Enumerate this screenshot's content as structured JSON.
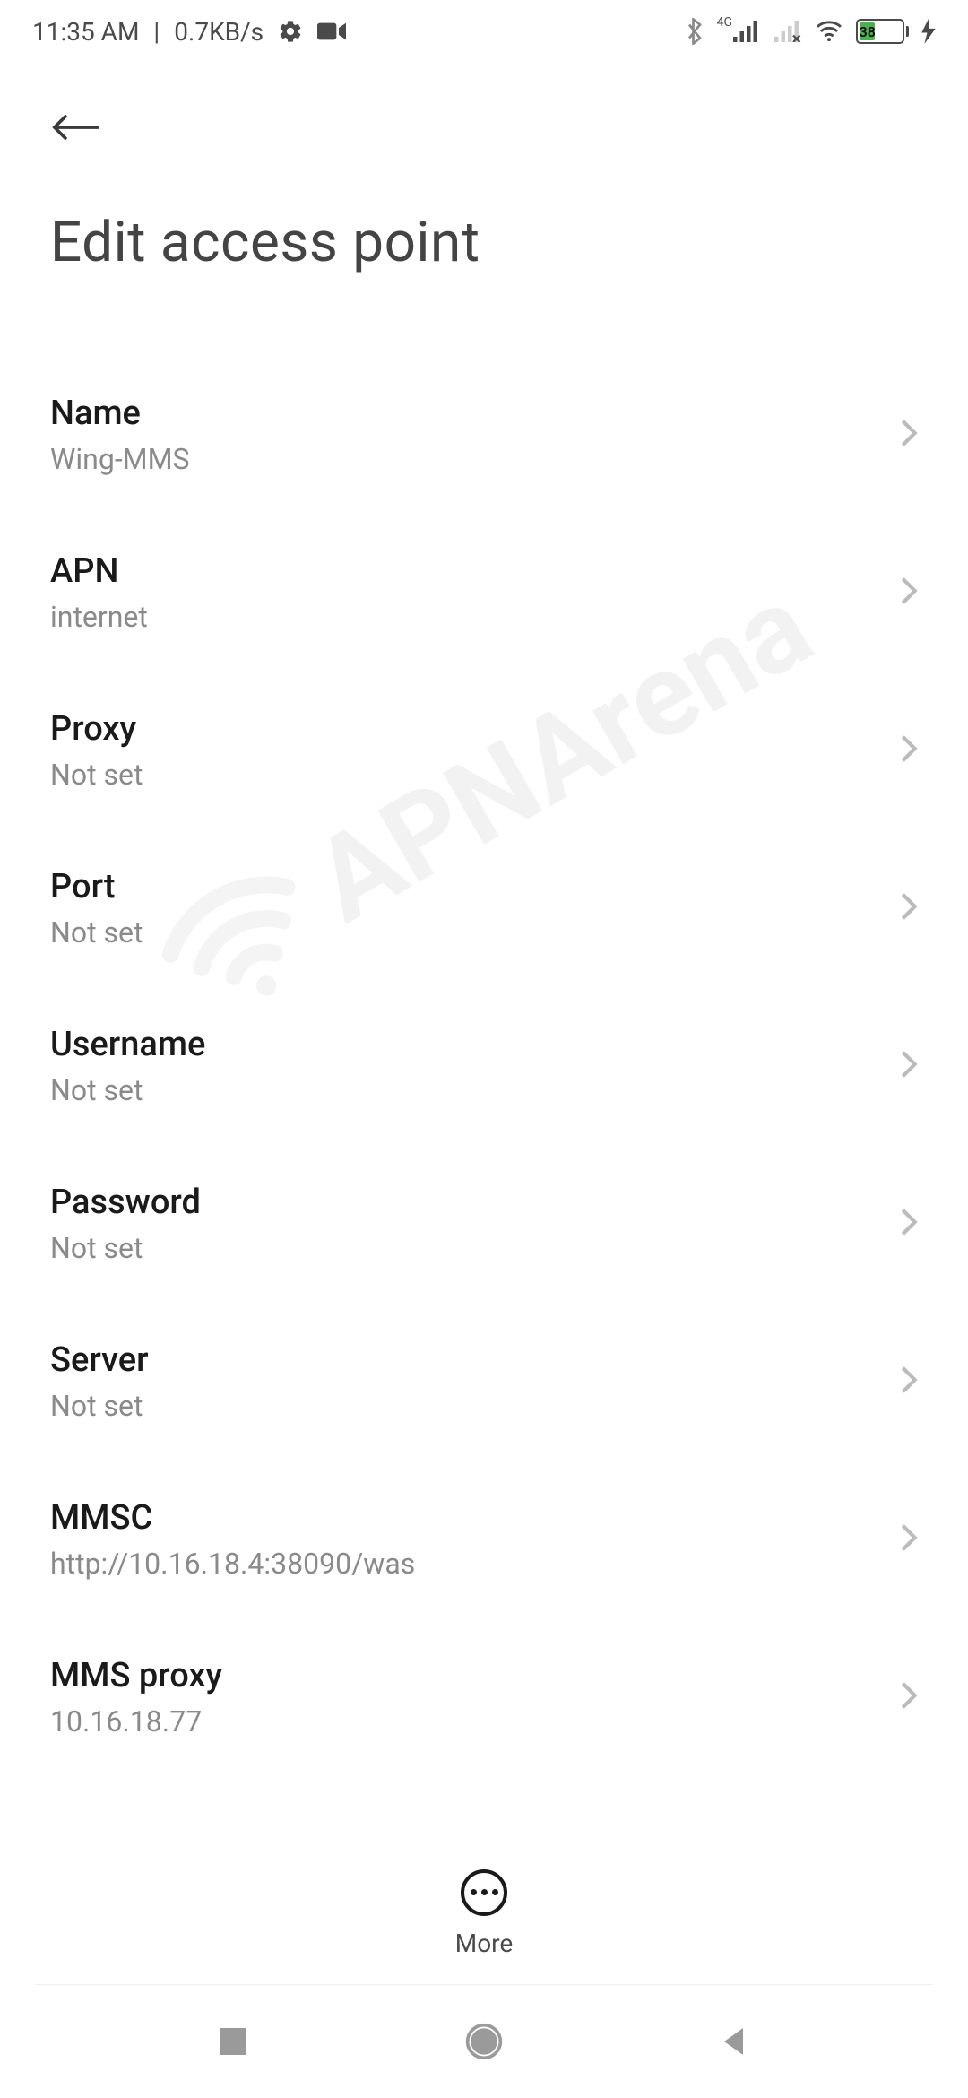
{
  "status_bar": {
    "time": "11:35 AM",
    "data_speed": "0.7KB/s",
    "signal_label": "4G",
    "battery_percent": "38"
  },
  "header": {
    "title": "Edit access point"
  },
  "settings": [
    {
      "label": "Name",
      "value": "Wing-MMS"
    },
    {
      "label": "APN",
      "value": "internet"
    },
    {
      "label": "Proxy",
      "value": "Not set"
    },
    {
      "label": "Port",
      "value": "Not set"
    },
    {
      "label": "Username",
      "value": "Not set"
    },
    {
      "label": "Password",
      "value": "Not set"
    },
    {
      "label": "Server",
      "value": "Not set"
    },
    {
      "label": "MMSC",
      "value": "http://10.16.18.4:38090/was"
    },
    {
      "label": "MMS proxy",
      "value": "10.16.18.77"
    }
  ],
  "action_bar": {
    "more_label": "More"
  },
  "watermark": {
    "text": "APNArena"
  }
}
